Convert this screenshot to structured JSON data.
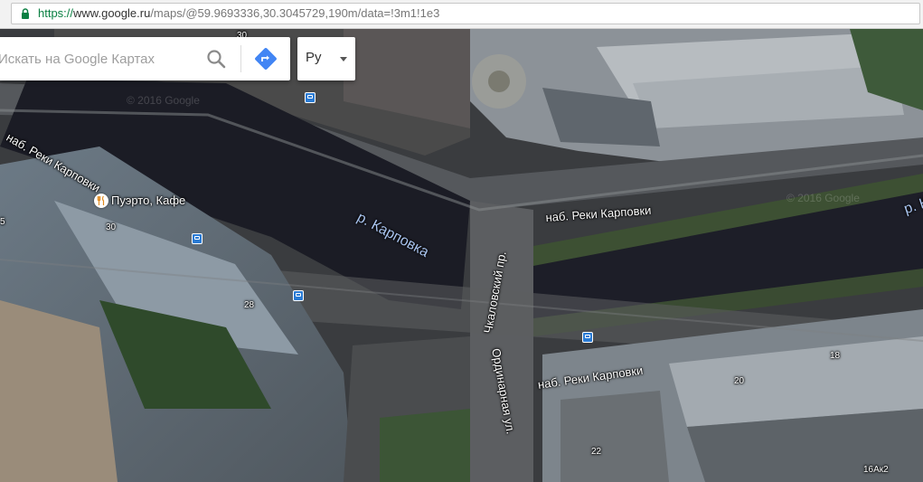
{
  "browser": {
    "url_secure_part": "https://",
    "url_host": "www.google.ru",
    "url_path": "/maps/@59.9693336,30.3045729,190m/data=!3m1!1e3"
  },
  "search": {
    "placeholder": "Искать на Google Картах"
  },
  "language": {
    "selected": "Ру"
  },
  "labels": {
    "street_top_left": "наб. Реки Карповки",
    "street_mid": "наб. Реки Карповки",
    "street_bottom": "наб. Реки Карповки",
    "river_main": "р. Карповка",
    "river_right": "р. К",
    "avenue_chkalovsky": "Чкаловский пр.",
    "street_ordinarnaya": "Ординарная ул.",
    "poi_name": "Пуэрто, Кафе",
    "house_30_top": "30",
    "house_30": "30",
    "house_28": "28",
    "house_20": "20",
    "house_18": "18",
    "house_22": "22",
    "house_16ak2": "16Ак2",
    "house_5": "5",
    "watermark_left": "© 2016 Google",
    "watermark_right": "© 2016 Google"
  },
  "colors": {
    "transit": "#2a7bd4",
    "river_label": "#a9c4ef",
    "direction_blue": "#4285f4"
  }
}
